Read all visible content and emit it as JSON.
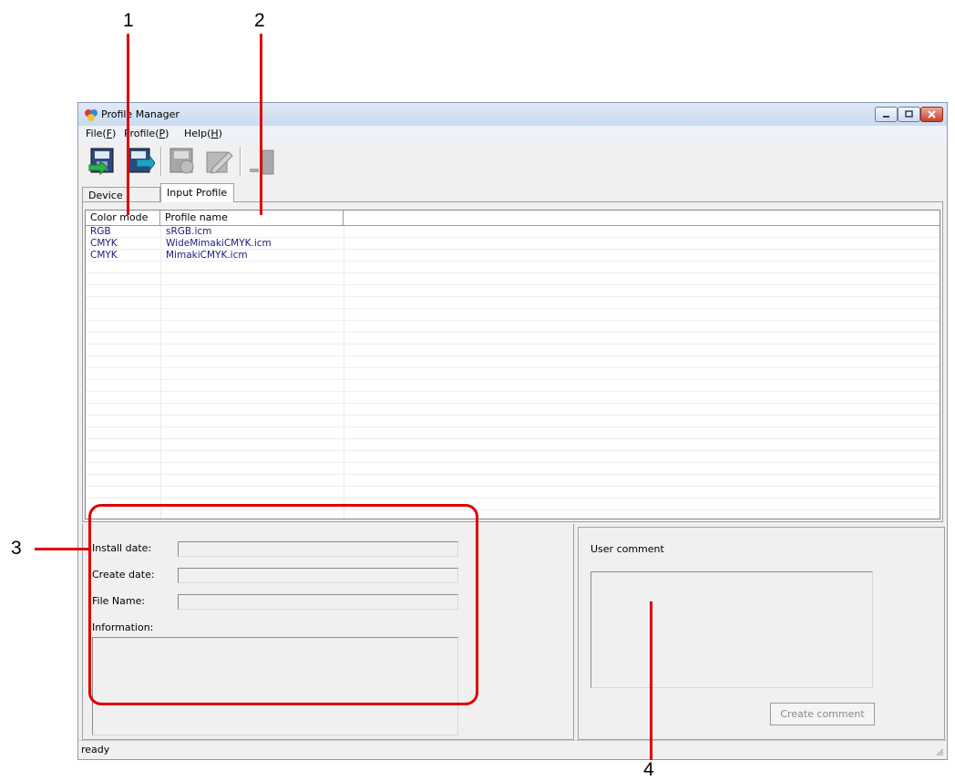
{
  "callouts": {
    "c1": "1",
    "c2": "2",
    "c3": "3",
    "c4": "4"
  },
  "window": {
    "title": "Profile Manager"
  },
  "menu": {
    "file": {
      "label": "File(",
      "key": "F",
      "end": ")"
    },
    "profile": {
      "label": "Profile(",
      "key": "P",
      "end": ")"
    },
    "help": {
      "label": "Help(",
      "key": "H",
      "end": ")"
    }
  },
  "toolbar": {
    "buttons": [
      "install-profile-icon",
      "export-profile-icon",
      "delete-profile-icon",
      "edit-profile-icon",
      "profile-info-icon"
    ]
  },
  "tabs": {
    "device": "Device Profile",
    "input": "Input Profile"
  },
  "list": {
    "columns": {
      "color_mode": "Color mode",
      "profile_name": "Profile name"
    },
    "rows": [
      {
        "color_mode": "RGB",
        "profile_name": "sRGB.icm"
      },
      {
        "color_mode": "CMYK",
        "profile_name": "WideMimakiCMYK.icm"
      },
      {
        "color_mode": "CMYK",
        "profile_name": "MimakiCMYK.icm"
      }
    ]
  },
  "details": {
    "install_date_label": "Install date:",
    "create_date_label": "Create date:",
    "file_name_label": "File Name:",
    "information_label": "Information:",
    "install_date": "",
    "create_date": "",
    "file_name": ""
  },
  "comment": {
    "label": "User comment",
    "button": "Create comment",
    "text": ""
  },
  "status": {
    "text": "ready"
  },
  "colors": {
    "callout": "#e00000",
    "title_gradient": "#c9dbf0",
    "list_text": "#1c1c7a"
  }
}
